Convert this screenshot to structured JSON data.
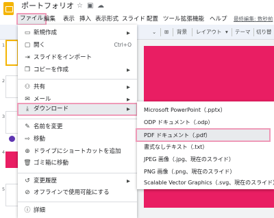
{
  "header": {
    "doc_title": "ポートフォリオ",
    "icons": [
      "star-icon",
      "move-to-folder-icon",
      "cloud-saved-icon"
    ],
    "last_edit": "最終編集: 数秒前"
  },
  "menubar": {
    "items": [
      "ファイル",
      "編集",
      "表示",
      "挿入",
      "表示形式",
      "スライド",
      "配置",
      "ツール",
      "拡張機能",
      "ヘルプ"
    ]
  },
  "toolbar": {
    "background_label": "背景",
    "layout_label": "レイアウト",
    "layout_arrow": "▾",
    "theme_label": "テーマ",
    "transition_label": "切り替"
  },
  "filmstrip": {
    "slide_numbers": [
      "1",
      "2",
      "3",
      "4",
      "5"
    ]
  },
  "file_menu": {
    "items": [
      {
        "icon": "new-icon",
        "glyph": "▭",
        "label": "新規作成",
        "arrow": "▶"
      },
      {
        "icon": "open-folder-icon",
        "glyph": "▢",
        "label": "開く",
        "shortcut": "Ctrl+O"
      },
      {
        "icon": "import-slides-icon",
        "glyph": "⇥",
        "label": "スライドをインポート"
      },
      {
        "icon": "copy-icon",
        "glyph": "❐",
        "label": "コピーを作成",
        "arrow": "▶"
      },
      {
        "icon": "share-icon",
        "glyph": "⚇",
        "label": "共有",
        "arrow": "▶"
      },
      {
        "icon": "email-icon",
        "glyph": "✉",
        "label": "メール",
        "arrow": "▶"
      },
      {
        "icon": "download-icon",
        "glyph": "⤓",
        "label": "ダウンロード",
        "arrow": "▶"
      },
      {
        "icon": "rename-icon",
        "glyph": "✎",
        "label": "名前を変更"
      },
      {
        "icon": "move-icon",
        "glyph": "⇨",
        "label": "移動"
      },
      {
        "icon": "drive-shortcut-icon",
        "glyph": "⊕",
        "label": "ドライブにショートカットを追加"
      },
      {
        "icon": "trash-icon",
        "glyph": "🗑",
        "label": "ゴミ箱に移動"
      },
      {
        "icon": "version-history-icon",
        "glyph": "↺",
        "label": "変更履歴",
        "arrow": "▶"
      },
      {
        "icon": "offline-icon",
        "glyph": "⊘",
        "label": "オフラインで使用可能にする"
      },
      {
        "icon": "details-icon",
        "glyph": "ⓘ",
        "label": "詳細"
      }
    ]
  },
  "download_submenu": {
    "items": [
      "Microsoft PowerPoint（.pptx）",
      "ODP ドキュメント（.odp）",
      "PDF ドキュメント（.pdf）",
      "書式なしテキスト（.txt）",
      "JPEG 画像（.jpg、現在のスライド）",
      "PNG 画像（.png、現在のスライド）",
      "Scalable Vector Graphics（.svg、現在のスライド）"
    ]
  },
  "colors": {
    "accent_slide": "#e91e63",
    "highlight_border": "#ef9ab8",
    "selected_thumb_border": "#f4b400"
  }
}
